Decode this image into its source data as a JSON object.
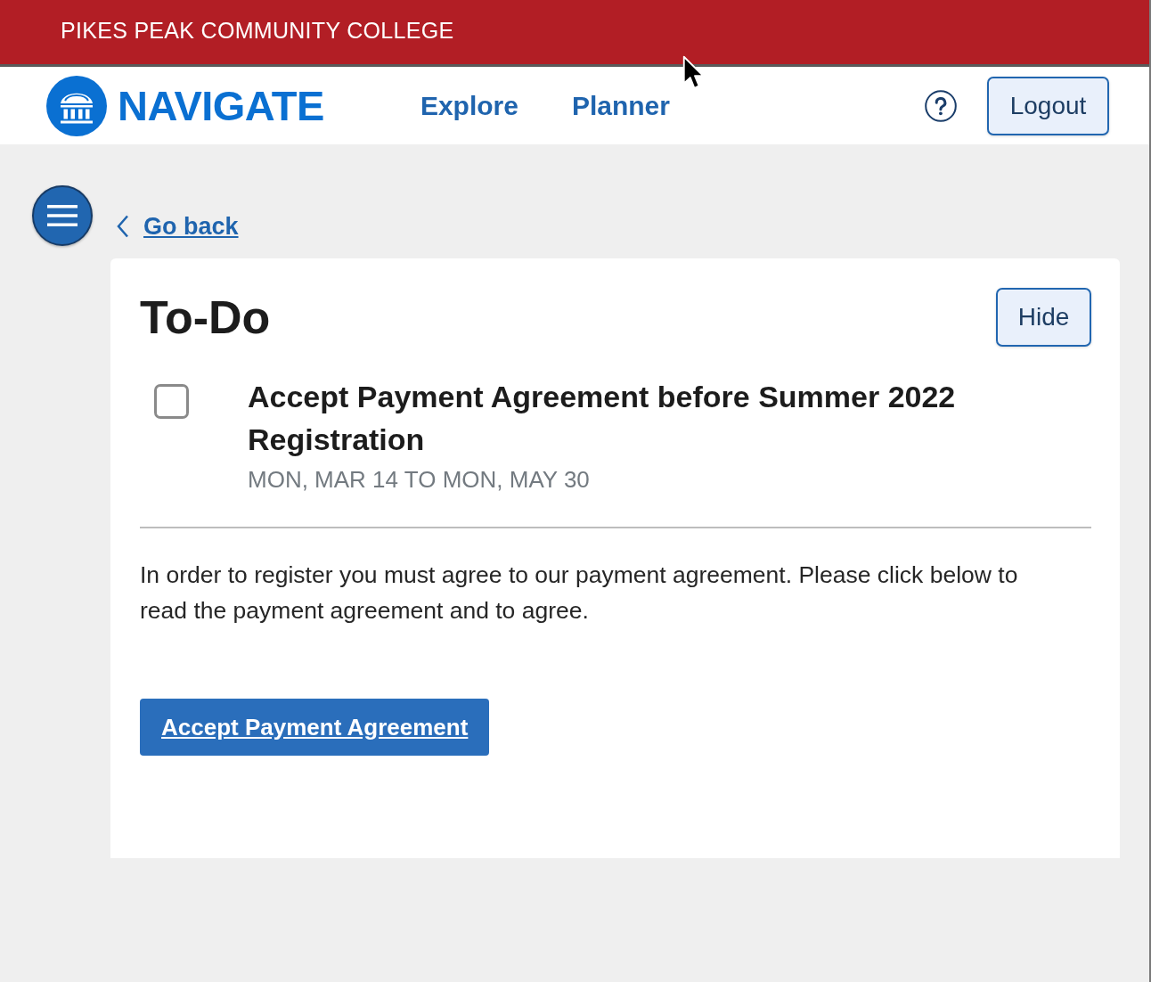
{
  "header": {
    "institution": "PIKES PEAK COMMUNITY COLLEGE"
  },
  "navbar": {
    "brand": "NAVIGATE",
    "links": [
      {
        "label": "Explore"
      },
      {
        "label": "Planner"
      }
    ],
    "logout": "Logout"
  },
  "page": {
    "back_link": "Go back"
  },
  "todo_card": {
    "title": "To-Do",
    "hide_button": "Hide",
    "items": [
      {
        "title": "Accept Payment Agreement before Summer 2022 Registration",
        "dates": "MON, MAR 14 TO MON, MAY 30",
        "checked": false
      }
    ],
    "description": "In order to register you must agree to our payment agreement. Please click below to read the payment agreement and to agree.",
    "action_button": "Accept Payment Agreement"
  }
}
